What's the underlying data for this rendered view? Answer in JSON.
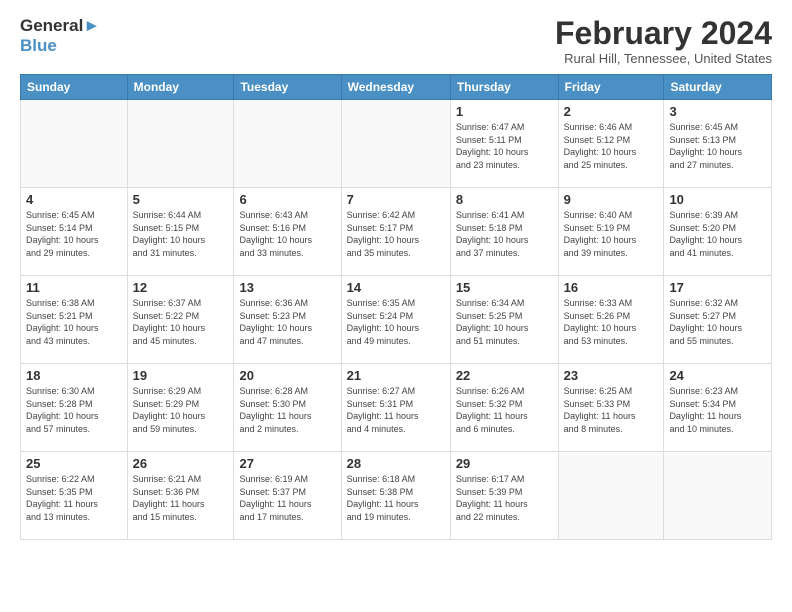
{
  "logo": {
    "line1": "General",
    "line2": "Blue"
  },
  "title": "February 2024",
  "location": "Rural Hill, Tennessee, United States",
  "days_header": [
    "Sunday",
    "Monday",
    "Tuesday",
    "Wednesday",
    "Thursday",
    "Friday",
    "Saturday"
  ],
  "weeks": [
    [
      {
        "num": "",
        "info": ""
      },
      {
        "num": "",
        "info": ""
      },
      {
        "num": "",
        "info": ""
      },
      {
        "num": "",
        "info": ""
      },
      {
        "num": "1",
        "info": "Sunrise: 6:47 AM\nSunset: 5:11 PM\nDaylight: 10 hours\nand 23 minutes."
      },
      {
        "num": "2",
        "info": "Sunrise: 6:46 AM\nSunset: 5:12 PM\nDaylight: 10 hours\nand 25 minutes."
      },
      {
        "num": "3",
        "info": "Sunrise: 6:45 AM\nSunset: 5:13 PM\nDaylight: 10 hours\nand 27 minutes."
      }
    ],
    [
      {
        "num": "4",
        "info": "Sunrise: 6:45 AM\nSunset: 5:14 PM\nDaylight: 10 hours\nand 29 minutes."
      },
      {
        "num": "5",
        "info": "Sunrise: 6:44 AM\nSunset: 5:15 PM\nDaylight: 10 hours\nand 31 minutes."
      },
      {
        "num": "6",
        "info": "Sunrise: 6:43 AM\nSunset: 5:16 PM\nDaylight: 10 hours\nand 33 minutes."
      },
      {
        "num": "7",
        "info": "Sunrise: 6:42 AM\nSunset: 5:17 PM\nDaylight: 10 hours\nand 35 minutes."
      },
      {
        "num": "8",
        "info": "Sunrise: 6:41 AM\nSunset: 5:18 PM\nDaylight: 10 hours\nand 37 minutes."
      },
      {
        "num": "9",
        "info": "Sunrise: 6:40 AM\nSunset: 5:19 PM\nDaylight: 10 hours\nand 39 minutes."
      },
      {
        "num": "10",
        "info": "Sunrise: 6:39 AM\nSunset: 5:20 PM\nDaylight: 10 hours\nand 41 minutes."
      }
    ],
    [
      {
        "num": "11",
        "info": "Sunrise: 6:38 AM\nSunset: 5:21 PM\nDaylight: 10 hours\nand 43 minutes."
      },
      {
        "num": "12",
        "info": "Sunrise: 6:37 AM\nSunset: 5:22 PM\nDaylight: 10 hours\nand 45 minutes."
      },
      {
        "num": "13",
        "info": "Sunrise: 6:36 AM\nSunset: 5:23 PM\nDaylight: 10 hours\nand 47 minutes."
      },
      {
        "num": "14",
        "info": "Sunrise: 6:35 AM\nSunset: 5:24 PM\nDaylight: 10 hours\nand 49 minutes."
      },
      {
        "num": "15",
        "info": "Sunrise: 6:34 AM\nSunset: 5:25 PM\nDaylight: 10 hours\nand 51 minutes."
      },
      {
        "num": "16",
        "info": "Sunrise: 6:33 AM\nSunset: 5:26 PM\nDaylight: 10 hours\nand 53 minutes."
      },
      {
        "num": "17",
        "info": "Sunrise: 6:32 AM\nSunset: 5:27 PM\nDaylight: 10 hours\nand 55 minutes."
      }
    ],
    [
      {
        "num": "18",
        "info": "Sunrise: 6:30 AM\nSunset: 5:28 PM\nDaylight: 10 hours\nand 57 minutes."
      },
      {
        "num": "19",
        "info": "Sunrise: 6:29 AM\nSunset: 5:29 PM\nDaylight: 10 hours\nand 59 minutes."
      },
      {
        "num": "20",
        "info": "Sunrise: 6:28 AM\nSunset: 5:30 PM\nDaylight: 11 hours\nand 2 minutes."
      },
      {
        "num": "21",
        "info": "Sunrise: 6:27 AM\nSunset: 5:31 PM\nDaylight: 11 hours\nand 4 minutes."
      },
      {
        "num": "22",
        "info": "Sunrise: 6:26 AM\nSunset: 5:32 PM\nDaylight: 11 hours\nand 6 minutes."
      },
      {
        "num": "23",
        "info": "Sunrise: 6:25 AM\nSunset: 5:33 PM\nDaylight: 11 hours\nand 8 minutes."
      },
      {
        "num": "24",
        "info": "Sunrise: 6:23 AM\nSunset: 5:34 PM\nDaylight: 11 hours\nand 10 minutes."
      }
    ],
    [
      {
        "num": "25",
        "info": "Sunrise: 6:22 AM\nSunset: 5:35 PM\nDaylight: 11 hours\nand 13 minutes."
      },
      {
        "num": "26",
        "info": "Sunrise: 6:21 AM\nSunset: 5:36 PM\nDaylight: 11 hours\nand 15 minutes."
      },
      {
        "num": "27",
        "info": "Sunrise: 6:19 AM\nSunset: 5:37 PM\nDaylight: 11 hours\nand 17 minutes."
      },
      {
        "num": "28",
        "info": "Sunrise: 6:18 AM\nSunset: 5:38 PM\nDaylight: 11 hours\nand 19 minutes."
      },
      {
        "num": "29",
        "info": "Sunrise: 6:17 AM\nSunset: 5:39 PM\nDaylight: 11 hours\nand 22 minutes."
      },
      {
        "num": "",
        "info": ""
      },
      {
        "num": "",
        "info": ""
      }
    ]
  ]
}
